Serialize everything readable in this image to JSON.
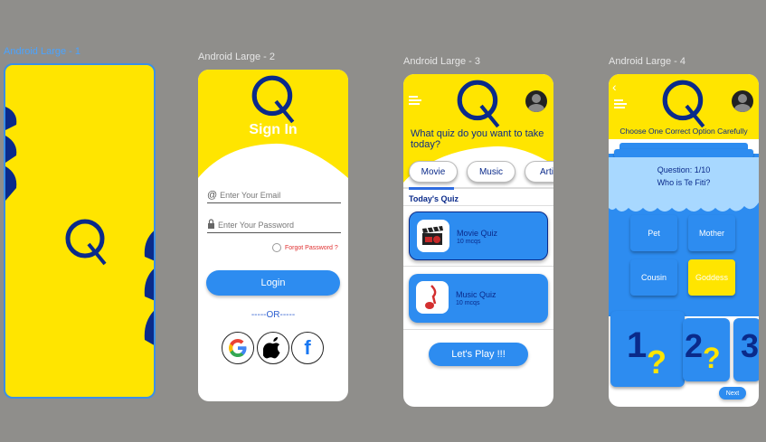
{
  "frames": {
    "f1": "Android Large - 1",
    "f2": "Android Large - 2",
    "f3": "Android Large - 3",
    "f4": "Android Large - 4"
  },
  "colors": {
    "yellow": "#ffe500",
    "navy": "#0a2a8a",
    "blue": "#2d8cf0",
    "canvas": "#8f8e8b",
    "selection": "#3b8fe6"
  },
  "signin": {
    "title": "Sign In",
    "email_placeholder": "Enter Your Email",
    "password_placeholder": "Enter Your Password",
    "forgot": "Forgot Password ?",
    "login": "Login",
    "or": "-----OR-----",
    "socials": [
      "google-icon",
      "apple-icon",
      "facebook-icon"
    ]
  },
  "home": {
    "question": "What quiz do you want to take today?",
    "tabs": [
      "Movie",
      "Music",
      "Arti"
    ],
    "section": "Today's Quiz",
    "quizzes": [
      {
        "title": "Movie Quiz",
        "sub": "10 mcqs",
        "icon": "clapperboard-icon"
      },
      {
        "title": "Music Quiz",
        "sub": "10 mcqs",
        "icon": "music-note-icon"
      }
    ],
    "play": "Let's Play !!!"
  },
  "quiz": {
    "instruction": "Choose One Correct Option Carefully",
    "progress": "Question: 1/10",
    "question": "Who is Te Fiti?",
    "options": [
      "Pet",
      "Mother",
      "Cousin",
      "Goddess"
    ],
    "numbers": [
      "1",
      "2",
      "3"
    ],
    "next": "Next"
  }
}
